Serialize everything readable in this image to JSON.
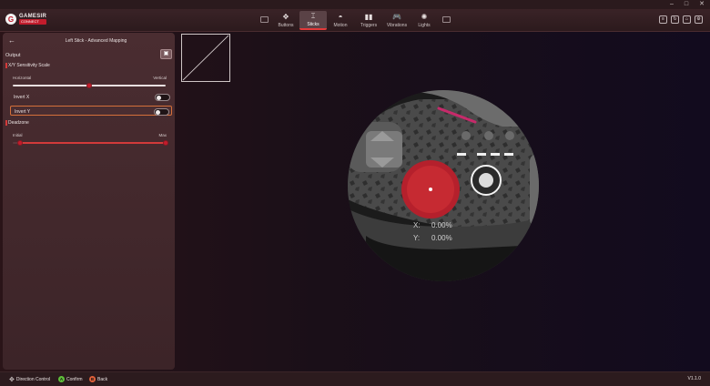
{
  "window_controls": {
    "minimize": "–",
    "maximize": "□",
    "close": "✕"
  },
  "logo": {
    "mark": "G",
    "line1": "GAMESIR",
    "line2": "CONNECT"
  },
  "nav": {
    "tabs": [
      {
        "label": "Buttons",
        "icon": "buttons-icon",
        "glyph": "✥"
      },
      {
        "label": "Sticks",
        "icon": "sticks-icon",
        "glyph": "⌶"
      },
      {
        "label": "Motion",
        "icon": "motion-icon",
        "glyph": "◓"
      },
      {
        "label": "Triggers",
        "icon": "triggers-icon",
        "glyph": "▮▮"
      },
      {
        "label": "Vibrations",
        "icon": "vibrations-icon",
        "glyph": "🎮"
      },
      {
        "label": "Lights",
        "icon": "lights-icon",
        "glyph": "✺"
      }
    ],
    "active": "Sticks"
  },
  "header_buttons": [
    "≡",
    "↻",
    "⌂",
    "⚙"
  ],
  "panel": {
    "back": "←",
    "title": "Left Stick - Advanced Mapping",
    "output_label": "Output",
    "output_icon": "▣",
    "xy_scale_label": "X/Y Sensitivity Scale",
    "horizontal_label": "Horizontal",
    "vertical_label": "Vertical",
    "xy_scale_value": 0.5,
    "invert_x_label": "Invert X",
    "invert_x": false,
    "invert_y_label": "Invert Y",
    "invert_y": false,
    "deadzone_label": "Deadzone",
    "initial_label": "Initial",
    "max_label": "Max",
    "deadzone_initial": 0.05,
    "deadzone_max": 1.0
  },
  "stick": {
    "x_label": "X:",
    "x_value": "0.00%",
    "y_label": "Y:",
    "y_value": "0.00%"
  },
  "bottom": {
    "direction_label": "Direction Control",
    "confirm_key": "A",
    "confirm_label": "Confirm",
    "back_key": "B",
    "back_label": "Back",
    "version": "V1.1.0"
  },
  "colors": {
    "accent": "#c21c2c",
    "confirm": "#5fbf3a",
    "back": "#e0603a"
  }
}
